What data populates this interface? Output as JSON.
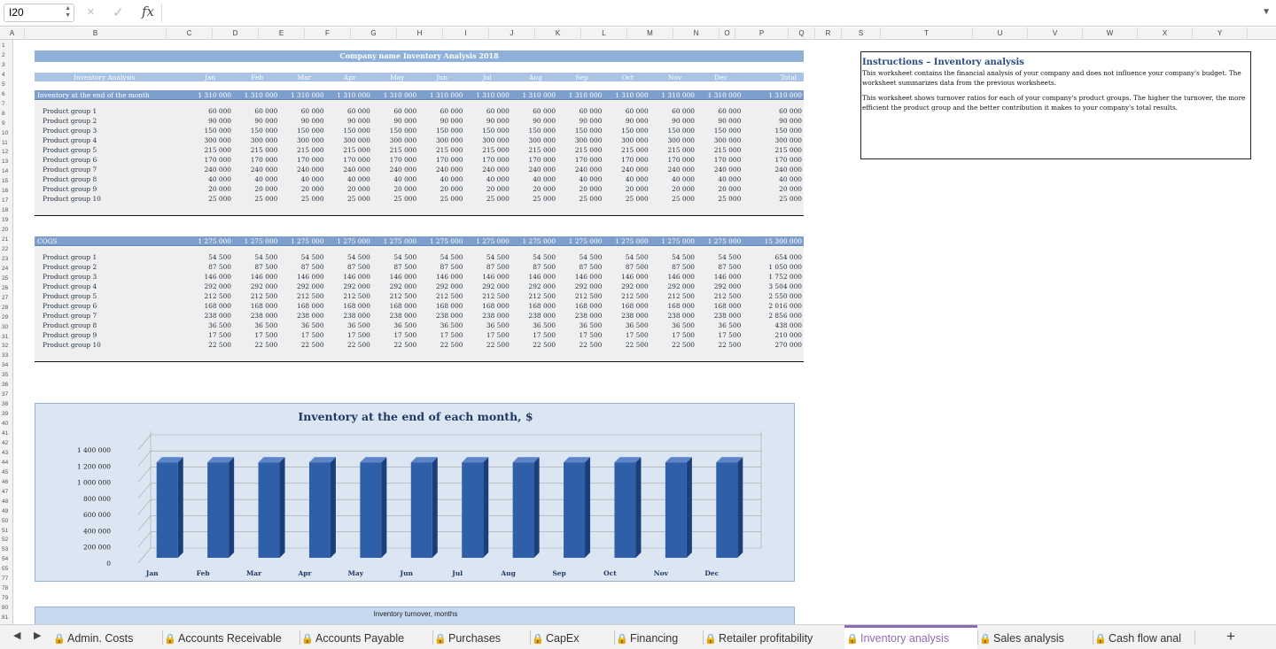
{
  "formula_bar": {
    "cell_ref": "I20",
    "cancel_icon": "×",
    "confirm_icon": "✓",
    "fx_label": "fx",
    "value": ""
  },
  "columns": [
    "A",
    "B",
    "C",
    "D",
    "E",
    "F",
    "G",
    "H",
    "I",
    "J",
    "K",
    "L",
    "M",
    "N",
    "O",
    "P",
    "Q",
    "R",
    "S",
    "T",
    "U",
    "V",
    "W",
    "X",
    "Y"
  ],
  "rows": [
    "1",
    "2",
    "3",
    "4",
    "5",
    "6",
    "7",
    "8",
    "9",
    "10",
    "11",
    "12",
    "13",
    "14",
    "15",
    "16",
    "17",
    "18",
    "19",
    "20",
    "21",
    "22",
    "23",
    "24",
    "25",
    "26",
    "27",
    "28",
    "29",
    "30",
    "31",
    "32",
    "33",
    "34",
    "35",
    "36",
    "37",
    "38",
    "39",
    "40",
    "41",
    "42",
    "43",
    "44",
    "45",
    "46",
    "47",
    "48",
    "49",
    "50",
    "51",
    "52",
    "53",
    "54",
    "55",
    "77",
    "78",
    "79",
    "80",
    "81",
    "82",
    "83"
  ],
  "sheet_title": "Company name Inventory Analysis 2018",
  "months": [
    "Jan",
    "Feb",
    "Mar",
    "Apr",
    "May",
    "Jun",
    "Jul",
    "Aug",
    "Sep",
    "Oct",
    "Nov",
    "Dec"
  ],
  "header_label": "Inventory Analysis",
  "total_label": "Total",
  "inventory": {
    "label": "Inventory at the end of the month",
    "monthly_totals": [
      "1 310 000",
      "1 310 000",
      "1 310 000",
      "1 310 000",
      "1 310 000",
      "1 310 000",
      "1 310 000",
      "1 310 000",
      "1 310 000",
      "1 310 000",
      "1 310 000",
      "1 310 000"
    ],
    "total": "1 310 000",
    "groups": [
      {
        "name": "Product group 1",
        "value": "60 000",
        "total": "60 000"
      },
      {
        "name": "Product group 2",
        "value": "90 000",
        "total": "90 000"
      },
      {
        "name": "Product group 3",
        "value": "150 000",
        "total": "150 000"
      },
      {
        "name": "Product group 4",
        "value": "300 000",
        "total": "300 000"
      },
      {
        "name": "Product group 5",
        "value": "215 000",
        "total": "215 000"
      },
      {
        "name": "Product group 6",
        "value": "170 000",
        "total": "170 000"
      },
      {
        "name": "Product group 7",
        "value": "240 000",
        "total": "240 000"
      },
      {
        "name": "Product group 8",
        "value": "40 000",
        "total": "40 000"
      },
      {
        "name": "Product group 9",
        "value": "20 000",
        "total": "20 000"
      },
      {
        "name": "Product group 10",
        "value": "25 000",
        "total": "25 000"
      }
    ]
  },
  "cogs": {
    "label": "COGS",
    "monthly_totals": [
      "1 275 000",
      "1 275 000",
      "1 275 000",
      "1 275 000",
      "1 275 000",
      "1 275 000",
      "1 275 000",
      "1 275 000",
      "1 275 000",
      "1 275 000",
      "1 275 000",
      "1 275 000"
    ],
    "total": "15 300 000",
    "groups": [
      {
        "name": "Product group 1",
        "value": "54 500",
        "total": "654 000"
      },
      {
        "name": "Product group 2",
        "value": "87 500",
        "total": "1 050 000"
      },
      {
        "name": "Product group 3",
        "value": "146 000",
        "total": "1 752 000"
      },
      {
        "name": "Product group 4",
        "value": "292 000",
        "total": "3 504 000"
      },
      {
        "name": "Product group 5",
        "value": "212 500",
        "total": "2 550 000"
      },
      {
        "name": "Product group 6",
        "value": "168 000",
        "total": "2 016 000"
      },
      {
        "name": "Product group 7",
        "value": "238 000",
        "total": "2 856 000"
      },
      {
        "name": "Product group 8",
        "value": "36 500",
        "total": "438 000"
      },
      {
        "name": "Product group 9",
        "value": "17 500",
        "total": "210 000"
      },
      {
        "name": "Product group 10",
        "value": "22 500",
        "total": "270 000"
      }
    ]
  },
  "instructions": {
    "title": "Instructions – Inventory analysis",
    "p1": "This worksheet contains the financial analysis of your company and does not influence your company's budget. The worksheet summarizes data from the previous worksheets.",
    "p2": "This worksheet shows turnover ratios for each of your company's product groups. The higher the turnover, the more efficient the product group and the better contribution it makes to your company's total results."
  },
  "chart_data": [
    {
      "type": "bar",
      "title": "Inventory at the end of each month, $",
      "categories": [
        "Jan",
        "Feb",
        "Mar",
        "Apr",
        "May",
        "Jun",
        "Jul",
        "Aug",
        "Sep",
        "Oct",
        "Nov",
        "Dec"
      ],
      "values": [
        1310000,
        1310000,
        1310000,
        1310000,
        1310000,
        1310000,
        1310000,
        1310000,
        1310000,
        1310000,
        1310000,
        1310000
      ],
      "yticks": [
        "0",
        "200 000",
        "400 000",
        "600 000",
        "800 000",
        "1 000 000",
        "1 200 000",
        "1 400 000"
      ],
      "ylim": [
        0,
        1400000
      ],
      "bar_color": "#2e5fa8",
      "grid": true
    },
    {
      "type": "bar",
      "title": "Inventory turnover, months"
    }
  ],
  "tabs": [
    "Admin. Costs",
    "Accounts Receivable",
    "Accounts Payable",
    "Purchases",
    "CapEx",
    "Financing",
    "Retailer profitability",
    "Inventory analysis",
    "Sales analysis",
    "Cash flow anal"
  ],
  "active_tab": "Inventory analysis",
  "add_sheet": "+"
}
